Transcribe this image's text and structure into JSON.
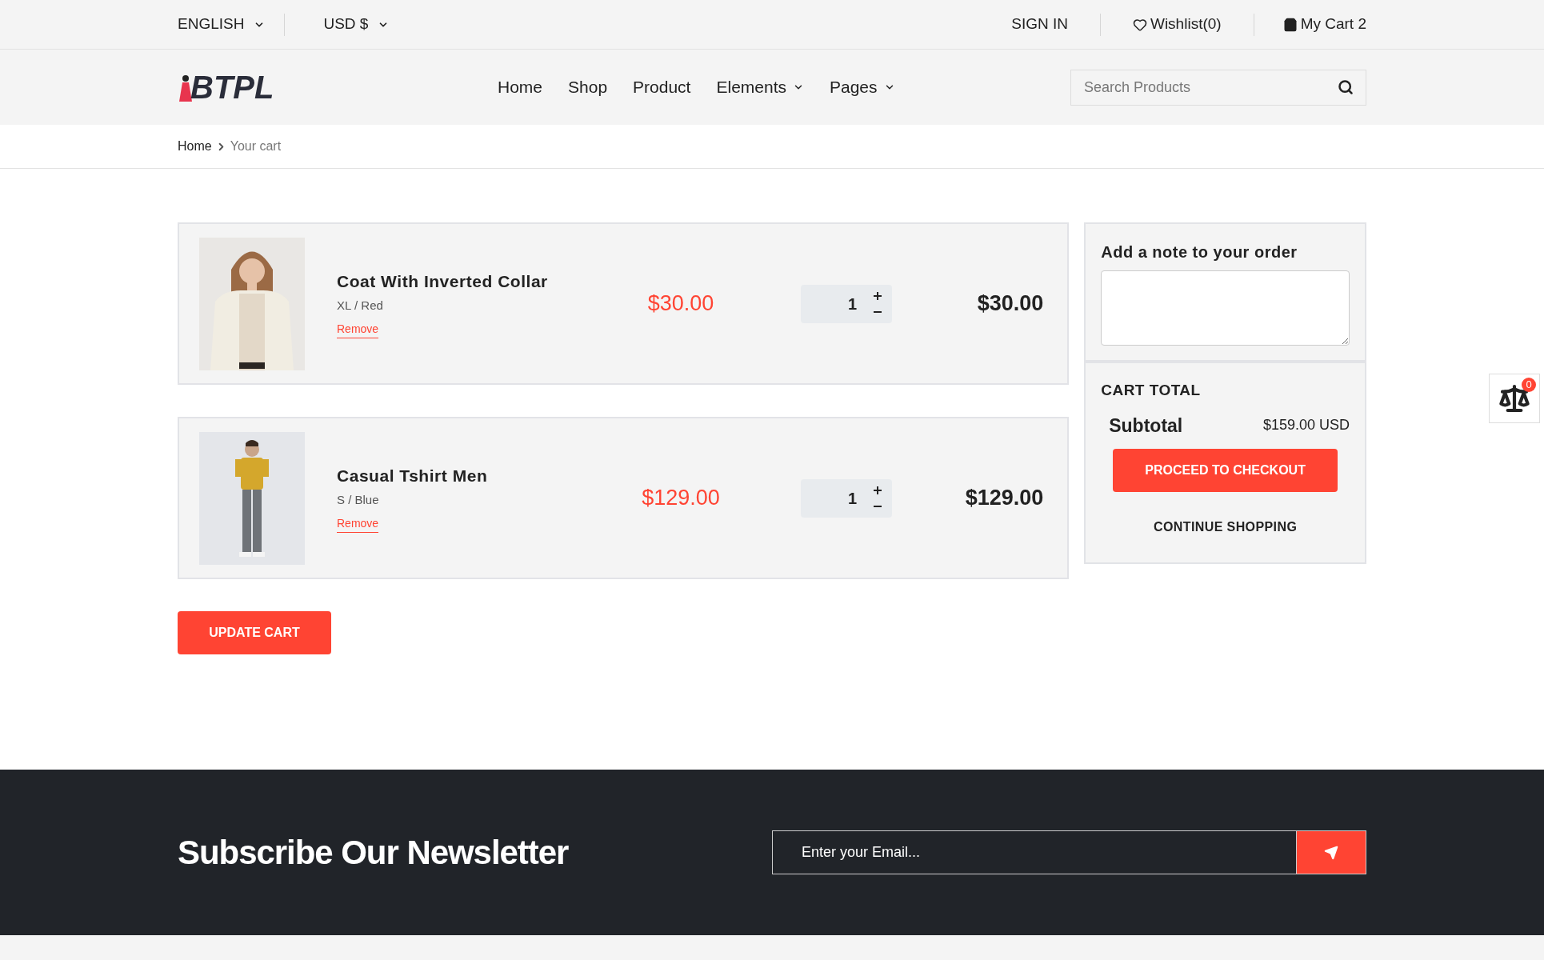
{
  "top_bar": {
    "language": "ENGLISH",
    "currency": "USD $",
    "sign_in": "SIGN IN",
    "wishlist": "Wishlist(0)",
    "cart": "My Cart 2"
  },
  "header": {
    "logo": "BTPL",
    "nav": [
      {
        "label": "Home",
        "dropdown": false
      },
      {
        "label": "Shop",
        "dropdown": false
      },
      {
        "label": "Product",
        "dropdown": false
      },
      {
        "label": "Elements",
        "dropdown": true
      },
      {
        "label": "Pages",
        "dropdown": true
      }
    ],
    "search": {
      "placeholder": "Search Products"
    }
  },
  "breadcrumb": [
    "Home",
    "Your cart"
  ],
  "cart_items": [
    {
      "name": "Coat With Inverted Collar",
      "variant": "XL / Red",
      "remove": "Remove",
      "price": "$30.00",
      "quantity": "1",
      "total": "$30.00"
    },
    {
      "name": "Casual Tshirt Men",
      "variant": "S / Blue",
      "remove": "Remove",
      "price": "$129.00",
      "quantity": "1",
      "total": "$129.00"
    }
  ],
  "update_button": "UPDATE CART",
  "note": {
    "label": "Add a note to your order"
  },
  "cart_total": {
    "title": "CART TOTAL",
    "subtotal_label": "Subtotal",
    "subtotal": "$159.00 USD",
    "checkout": "PROCEED TO CHECKOUT",
    "continue": "CONTINUE SHOPPING"
  },
  "compare_widget": {
    "count": "0"
  },
  "newsletter": {
    "title": "Subscribe Our Newsletter",
    "placeholder": "Enter your Email..."
  }
}
